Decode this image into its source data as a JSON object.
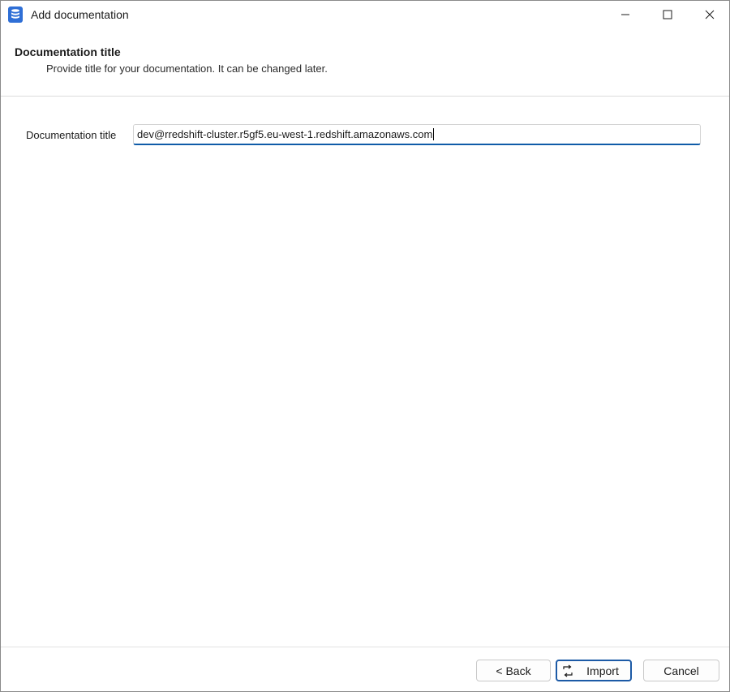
{
  "window": {
    "title": "Add documentation"
  },
  "header": {
    "title": "Documentation title",
    "subtitle": "Provide title for your documentation. It can be changed later."
  },
  "form": {
    "title_label": "Documentation title",
    "title_value": "dev@rredshift-cluster.r5gf5.eu-west-1.redshift.amazonaws.com"
  },
  "footer": {
    "back_label": "< Back",
    "import_label": "Import",
    "cancel_label": "Cancel"
  },
  "icons": {
    "app": "database-icon",
    "import": "import-icon"
  },
  "colors": {
    "accent": "#0f5ba8",
    "app_icon": "#2f6fd6"
  }
}
